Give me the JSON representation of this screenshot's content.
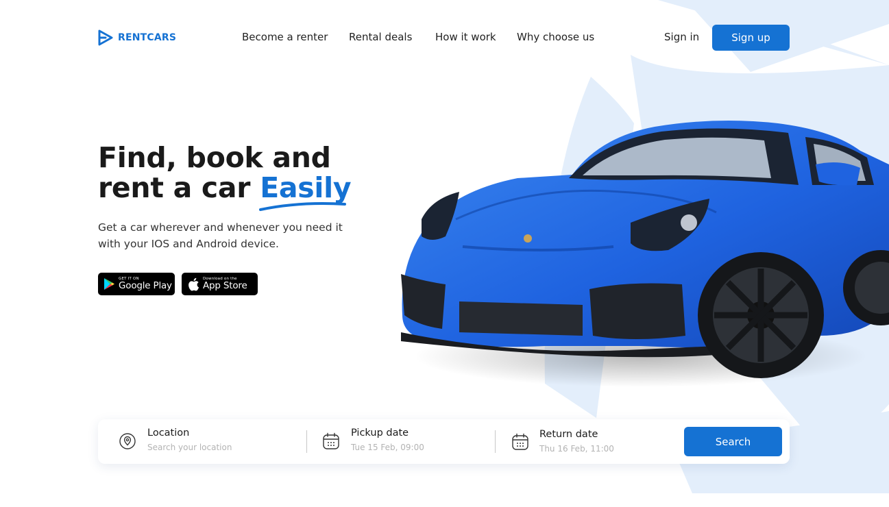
{
  "brand": {
    "name": "RENTCARS",
    "accent": "#1572d3"
  },
  "nav": {
    "items": [
      {
        "label": "Become a renter"
      },
      {
        "label": "Rental deals"
      },
      {
        "label": "How it work"
      },
      {
        "label": "Why choose us"
      }
    ]
  },
  "auth": {
    "signin_label": "Sign in",
    "signup_label": "Sign up"
  },
  "hero": {
    "title_line1": "Find, book and",
    "title_line2_prefix": "rent a car ",
    "title_accent": "Easily",
    "subtitle": "Get a car wherever and whenever you need it with your IOS and Android device."
  },
  "stores": {
    "google": {
      "small": "GET IT ON",
      "big": "Google Play",
      "icon": "google-play-icon"
    },
    "apple": {
      "small": "Download on the",
      "big": "App Store",
      "icon": "apple-icon"
    }
  },
  "search": {
    "location": {
      "label": "Location",
      "placeholder": "Search your location",
      "icon": "location-pin-icon"
    },
    "pickup": {
      "label": "Pickup date",
      "value": "Tue 15 Feb, 09:00",
      "icon": "calendar-icon"
    },
    "return": {
      "label": "Return date",
      "value": "Thu 16 Feb, 11:00",
      "icon": "calendar-icon"
    },
    "button_label": "Search"
  },
  "colors": {
    "primary": "#1572d3",
    "backdrop": "#e3eefb",
    "car": "#1f63e0"
  }
}
